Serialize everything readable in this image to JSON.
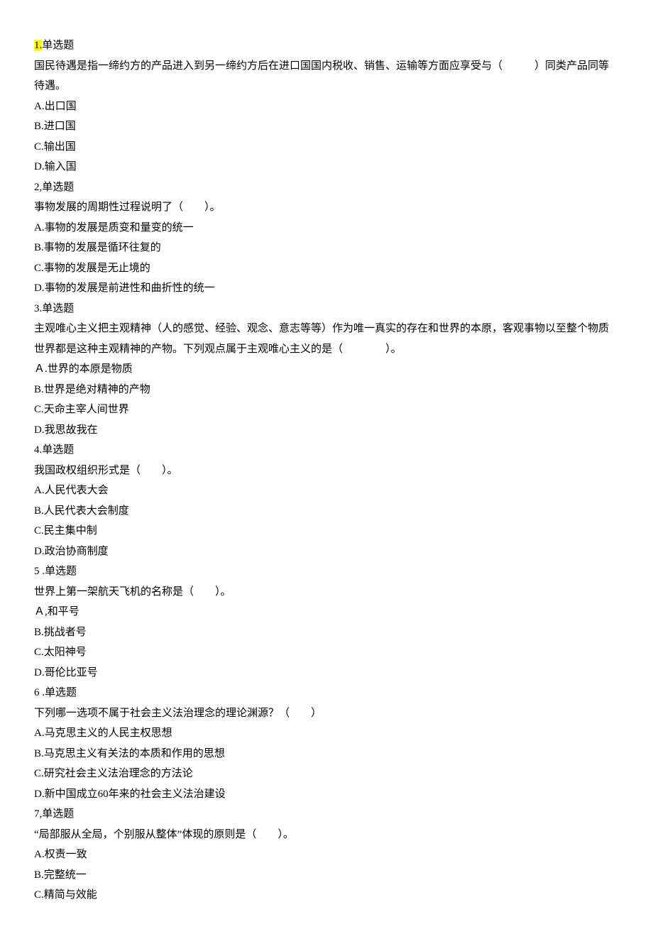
{
  "questions": [
    {
      "num": "1.",
      "label": "单选题",
      "stem_before": "国民待遇是指一缔约方的产品进入到另一缔约方后在进口国国内税收、销售、运输等方面应享受与（",
      "blank": "            ",
      "stem_after": "）同类产品同等待遇。",
      "options": [
        "A.出口国",
        "B.进口国",
        "C.输出国",
        "D.输入国"
      ]
    },
    {
      "num": "2,",
      "label": "单选题",
      "stem_before": "事物发展的周期性过程说明了（",
      "blank": "        ",
      "stem_after": "）。",
      "options": [
        "A.事物的发展是质变和量变的统一",
        "B.事物的发展是循环往复的",
        "C.事物的发展是无止境的",
        "D.事物的发展是前进性和曲折性的统一"
      ]
    },
    {
      "num": "3.",
      "label": "单选题",
      "stem_before": "主观唯心主义把主观精神（人的感觉、经验、观念、意志等等）作为唯一真实的存在和世界的本原，客观事物以至整个物质世界都是这种主观精神的产物。下列观点属于主观唯心主义的是（",
      "blank": "                ",
      "stem_after": "）。",
      "options": [
        "Ａ.世界的本原是物质",
        "B.世界是绝对精神的产物",
        "C.天命主宰人间世界",
        "D.我思故我在"
      ]
    },
    {
      "num": "4.",
      "label": "单选题",
      "stem_before": "我国政权组织形式是（",
      "blank": "        ",
      "stem_after": "）。",
      "options": [
        "A.人民代表大会",
        "B.人民代表大会制度",
        "C.民主集中制",
        "D.政治协商制度"
      ]
    },
    {
      "num": "5  .",
      "label": "单选题",
      "stem_before": "世界上第一架航天飞机的名称是（",
      "blank": "        ",
      "stem_after": "）。",
      "options": [
        "Ａ,和平号",
        "B.挑战者号",
        "C.太阳神号",
        "D.哥伦比亚号"
      ]
    },
    {
      "num": "6  .",
      "label": "单选题",
      "stem_before": "下列哪一选项不属于社会主义法治理念的理论渊源？（",
      "blank": "        ",
      "stem_after": "）",
      "options": [
        "A.马克思主义的人民主权思想",
        "B.马克思主义有关法的本质和作用的思想",
        "C.研究社会主义法治理念的方法论",
        "D.新中国成立60年来的社会主义法治建设"
      ]
    },
    {
      "num": "7,",
      "label": "单选题",
      "stem_before": "“局部服从全局，个别服从整体”体现的原则是（",
      "blank": "        ",
      "stem_after": "）。",
      "options": [
        "A.权责一致",
        "B.完整统一",
        "C.精简与效能"
      ]
    }
  ]
}
